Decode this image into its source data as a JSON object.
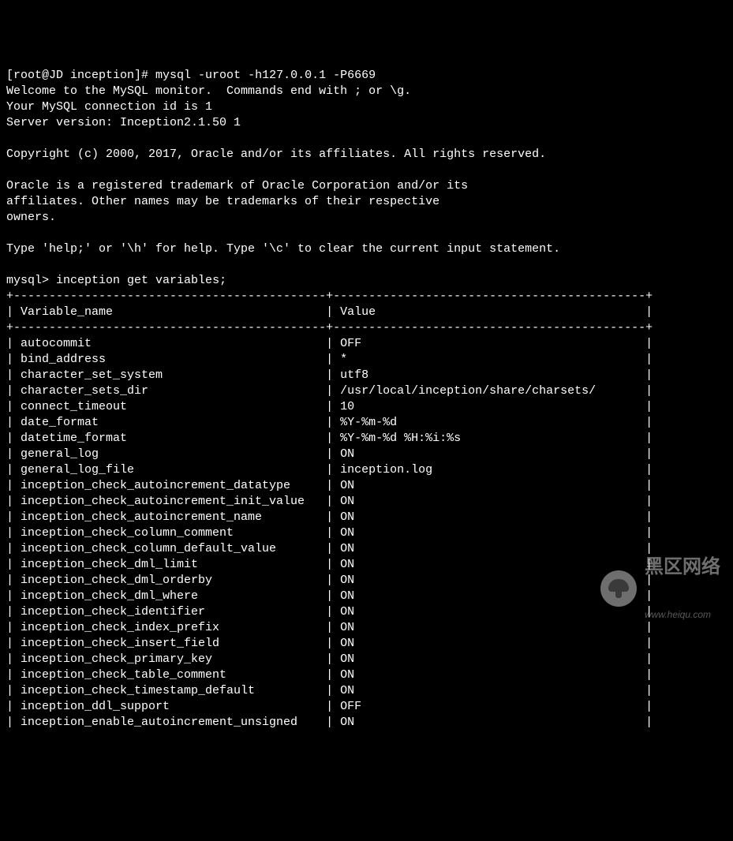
{
  "prompt": {
    "user_host": "[root@JD inception]#",
    "command": "mysql -uroot -h127.0.0.1 -P6669"
  },
  "banner": {
    "line1": "Welcome to the MySQL monitor.  Commands end with ; or \\g.",
    "line2": "Your MySQL connection id is 1",
    "line3": "Server version: Inception2.1.50 1",
    "copyright": "Copyright (c) 2000, 2017, Oracle and/or its affiliates. All rights reserved.",
    "trademark1": "Oracle is a registered trademark of Oracle Corporation and/or its",
    "trademark2": "affiliates. Other names may be trademarks of their respective",
    "trademark3": "owners.",
    "help": "Type 'help;' or '\\h' for help. Type '\\c' to clear the current input statement."
  },
  "query": {
    "prompt": "mysql>",
    "text": "inception get variables;"
  },
  "table": {
    "col1_header": "Variable_name",
    "col2_header": "Value",
    "col1_width": 44,
    "col2_width": 44,
    "rows": [
      [
        "autocommit",
        "OFF"
      ],
      [
        "bind_address",
        "*"
      ],
      [
        "character_set_system",
        "utf8"
      ],
      [
        "character_sets_dir",
        "/usr/local/inception/share/charsets/"
      ],
      [
        "connect_timeout",
        "10"
      ],
      [
        "date_format",
        "%Y-%m-%d"
      ],
      [
        "datetime_format",
        "%Y-%m-%d %H:%i:%s"
      ],
      [
        "general_log",
        "ON"
      ],
      [
        "general_log_file",
        "inception.log"
      ],
      [
        "inception_check_autoincrement_datatype",
        "ON"
      ],
      [
        "inception_check_autoincrement_init_value",
        "ON"
      ],
      [
        "inception_check_autoincrement_name",
        "ON"
      ],
      [
        "inception_check_column_comment",
        "ON"
      ],
      [
        "inception_check_column_default_value",
        "ON"
      ],
      [
        "inception_check_dml_limit",
        "ON"
      ],
      [
        "inception_check_dml_orderby",
        "ON"
      ],
      [
        "inception_check_dml_where",
        "ON"
      ],
      [
        "inception_check_identifier",
        "ON"
      ],
      [
        "inception_check_index_prefix",
        "ON"
      ],
      [
        "inception_check_insert_field",
        "ON"
      ],
      [
        "inception_check_primary_key",
        "ON"
      ],
      [
        "inception_check_table_comment",
        "ON"
      ],
      [
        "inception_check_timestamp_default",
        "ON"
      ],
      [
        "inception_ddl_support",
        "OFF"
      ],
      [
        "inception_enable_autoincrement_unsigned",
        "ON"
      ]
    ]
  },
  "watermark": {
    "title": "黑区网络",
    "url": "www.heiqu.com"
  }
}
